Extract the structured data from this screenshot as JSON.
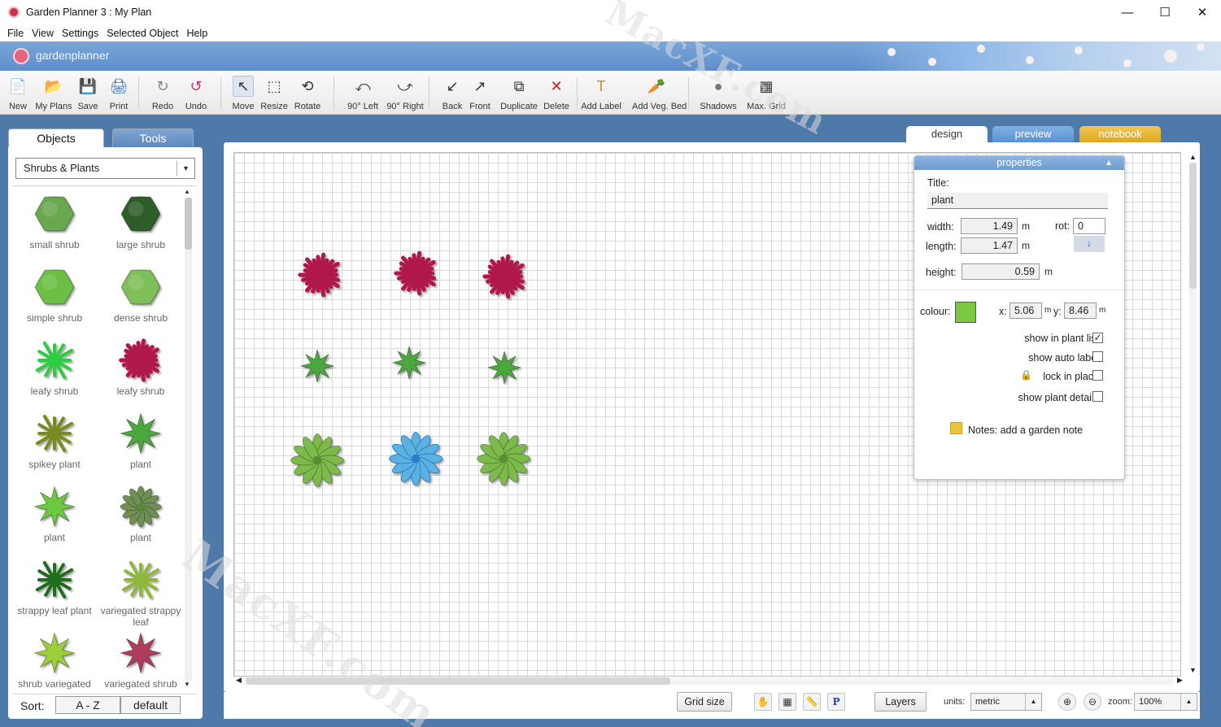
{
  "window": {
    "title": "Garden Planner 3 : My  Plan",
    "controls": [
      "—",
      "☐",
      "✕"
    ]
  },
  "menu": [
    "File",
    "View",
    "Settings",
    "Selected Object",
    "Help"
  ],
  "brand": {
    "name": "gardenplanner"
  },
  "toolbar": [
    {
      "id": "new",
      "label": "New",
      "icon": "📄"
    },
    {
      "id": "my-plans",
      "label": "My Plans",
      "icon": "📂"
    },
    {
      "id": "save",
      "label": "Save",
      "icon": "💾"
    },
    {
      "id": "print",
      "label": "Print",
      "icon": "🖨"
    },
    {
      "id": "redo",
      "label": "Redo",
      "icon": "↻"
    },
    {
      "id": "undo",
      "label": "Undo",
      "icon": "↺"
    },
    {
      "id": "move",
      "label": "Move",
      "icon": "↖"
    },
    {
      "id": "resize",
      "label": "Resize",
      "icon": "⬚"
    },
    {
      "id": "rotate",
      "label": "Rotate",
      "icon": "⟲"
    },
    {
      "id": "rotate-left",
      "label": "90° Left",
      "icon": "⤺"
    },
    {
      "id": "rotate-right",
      "label": "90° Right",
      "icon": "⤻"
    },
    {
      "id": "back",
      "label": "Back",
      "icon": "↙"
    },
    {
      "id": "front",
      "label": "Front",
      "icon": "↗"
    },
    {
      "id": "duplicate",
      "label": "Duplicate",
      "icon": "⧉"
    },
    {
      "id": "delete",
      "label": "Delete",
      "icon": "✕"
    },
    {
      "id": "add-label",
      "label": "Add Label",
      "icon": "T"
    },
    {
      "id": "add-veg-bed",
      "label": "Add Veg. Bed",
      "icon": "🥕"
    },
    {
      "id": "shadows",
      "label": "Shadows",
      "icon": "●"
    },
    {
      "id": "max-grid",
      "label": "Max. Grid",
      "icon": "▦"
    }
  ],
  "left_panel": {
    "tabs": [
      "Objects",
      "Tools"
    ],
    "category": "Shrubs & Plants",
    "items": [
      {
        "label": "small shrub",
        "color": "#6aa84f"
      },
      {
        "label": "large shrub",
        "color": "#2f5d2a"
      },
      {
        "label": "simple shrub",
        "color": "#6cbf45"
      },
      {
        "label": "dense shrub",
        "color": "#7fbf5a"
      },
      {
        "label": "leafy shrub",
        "color": "#2ecc40"
      },
      {
        "label": "leafy shrub",
        "color": "#b0184a"
      },
      {
        "label": "spikey plant",
        "color": "#7b8a1e"
      },
      {
        "label": "plant",
        "color": "#4aa83c"
      },
      {
        "label": "plant",
        "color": "#6cc83f"
      },
      {
        "label": "plant",
        "color": "#6f8f55"
      },
      {
        "label": "strappy leaf plant",
        "color": "#1e6e1e"
      },
      {
        "label": "variegated strappy leaf",
        "color": "#8fb83a"
      },
      {
        "label": "shrub variegated",
        "color": "#9ccf3a"
      },
      {
        "label": "variegated shrub",
        "color": "#b03c5c"
      }
    ],
    "sort": {
      "label": "Sort:",
      "az": "A - Z",
      "default": "default"
    }
  },
  "right_tabs": [
    "design",
    "preview",
    "notebook"
  ],
  "canvas_plants": [
    {
      "kind": "leafy",
      "color": "#b0184a"
    },
    {
      "kind": "leafy",
      "color": "#b0184a"
    },
    {
      "kind": "leafy",
      "color": "#b0184a"
    },
    {
      "kind": "star",
      "color": "#4aa83c"
    },
    {
      "kind": "star",
      "color": "#4aa83c"
    },
    {
      "kind": "star",
      "color": "#4aa83c"
    },
    {
      "kind": "rosette",
      "color": "#7cba4a"
    },
    {
      "kind": "rosette-selected",
      "color": "#5bb2e0"
    },
    {
      "kind": "rosette",
      "color": "#7cba4a"
    }
  ],
  "properties": {
    "header": "properties",
    "title_label": "Title:",
    "title_value": "plant",
    "width_label": "width:",
    "width_value": "1.49",
    "length_label": "length:",
    "length_value": "1.47",
    "height_label": "height:",
    "height_value": "0.59",
    "unit": "m",
    "rot_label": "rot:",
    "rot_value": "0",
    "colour_label": "colour:",
    "colour_value": "#7bc843",
    "x_label": "x:",
    "x_value": "5.06",
    "y_label": "y:",
    "y_value": "8.46",
    "show_in_plant_list": "show in plant list",
    "show_auto_label": "show auto label",
    "lock_in_place": "lock in place",
    "show_plant_details": "show plant details",
    "notes": "Notes: add a garden note"
  },
  "bottom": {
    "grid_size": "Grid size",
    "layers": "Layers",
    "units_label": "units:",
    "units_value": "metric",
    "zoom_label": "zoom:",
    "zoom_value": "100%"
  },
  "watermark": "MacXF.com"
}
